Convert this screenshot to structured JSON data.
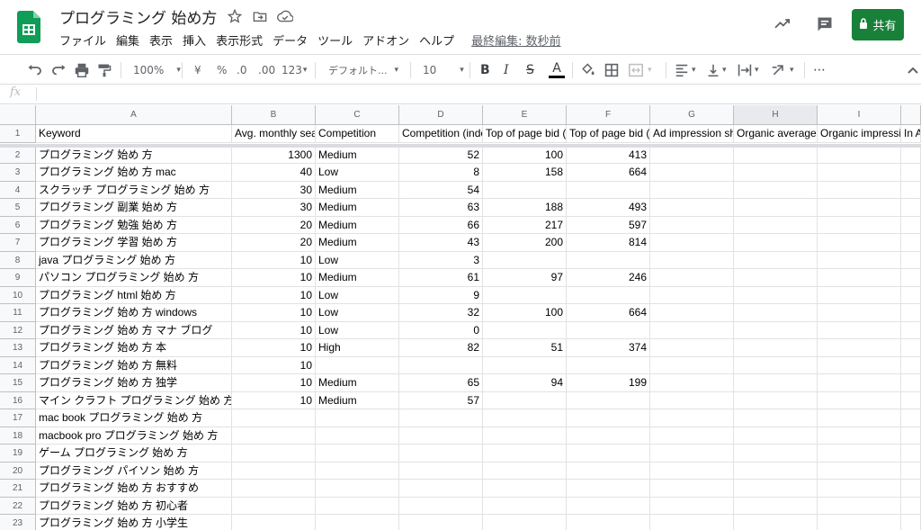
{
  "doc": {
    "title": "プログラミング 始め方",
    "menus": [
      "ファイル",
      "編集",
      "表示",
      "挿入",
      "表示形式",
      "データ",
      "ツール",
      "アドオン",
      "ヘルプ"
    ],
    "last_edit": "最終編集: 数秒前",
    "share_label": "共有"
  },
  "toolbar": {
    "zoom": "100%",
    "currency": "¥",
    "percent": "%",
    "dec_less": ".0",
    "dec_more": ".00",
    "format_more": "123",
    "font": "デフォルト...",
    "font_size": "10",
    "bold": "B",
    "italic": "I",
    "strike": "S",
    "text_color": "A",
    "more": "⋯"
  },
  "formula_bar": {
    "fx": "fx",
    "value": ""
  },
  "colors": {
    "share_green": "#188038",
    "logo_green": "#0f9d58",
    "text_color_bar": "#000000"
  },
  "sheet": {
    "columns": [
      "A",
      "B",
      "C",
      "D",
      "E",
      "F",
      "G",
      "H",
      "I",
      ""
    ],
    "selected_column": "H",
    "rows": [
      [
        "Keyword",
        "Avg. monthly searches",
        "Competition",
        "Competition (indexed value)",
        "Top of page bid (low range)",
        "Top of page bid (high range)",
        "Ad impression share",
        "Organic average position",
        "Organic impression share",
        "In Account"
      ],
      [
        "プログラミング 始め 方",
        "1300",
        "Medium",
        "52",
        "100",
        "413",
        "",
        "",
        "",
        ""
      ],
      [
        "プログラミング 始め 方 mac",
        "40",
        "Low",
        "8",
        "158",
        "664",
        "",
        "",
        "",
        ""
      ],
      [
        "スクラッチ プログラミング 始め 方",
        "30",
        "Medium",
        "54",
        "",
        "",
        "",
        "",
        "",
        ""
      ],
      [
        "プログラミング 副業 始め 方",
        "30",
        "Medium",
        "63",
        "188",
        "493",
        "",
        "",
        "",
        ""
      ],
      [
        "プログラミング 勉強 始め 方",
        "20",
        "Medium",
        "66",
        "217",
        "597",
        "",
        "",
        "",
        ""
      ],
      [
        "プログラミング 学習 始め 方",
        "20",
        "Medium",
        "43",
        "200",
        "814",
        "",
        "",
        "",
        ""
      ],
      [
        "java プログラミング 始め 方",
        "10",
        "Low",
        "3",
        "",
        "",
        "",
        "",
        "",
        ""
      ],
      [
        "パソコン プログラミング 始め 方",
        "10",
        "Medium",
        "61",
        "97",
        "246",
        "",
        "",
        "",
        ""
      ],
      [
        "プログラミング html 始め 方",
        "10",
        "Low",
        "9",
        "",
        "",
        "",
        "",
        "",
        ""
      ],
      [
        "プログラミング 始め 方 windows",
        "10",
        "Low",
        "32",
        "100",
        "664",
        "",
        "",
        "",
        ""
      ],
      [
        "プログラミング 始め 方 マナ ブログ",
        "10",
        "Low",
        "0",
        "",
        "",
        "",
        "",
        "",
        ""
      ],
      [
        "プログラミング 始め 方 本",
        "10",
        "High",
        "82",
        "51",
        "374",
        "",
        "",
        "",
        ""
      ],
      [
        "プログラミング 始め 方 無料",
        "10",
        "",
        "",
        "",
        "",
        "",
        "",
        "",
        ""
      ],
      [
        "プログラミング 始め 方 独学",
        "10",
        "Medium",
        "65",
        "94",
        "199",
        "",
        "",
        "",
        ""
      ],
      [
        "マイン クラフト プログラミング 始め 方",
        "10",
        "Medium",
        "57",
        "",
        "",
        "",
        "",
        "",
        ""
      ],
      [
        "mac book プログラミング 始め 方",
        "",
        "",
        "",
        "",
        "",
        "",
        "",
        "",
        ""
      ],
      [
        "macbook pro プログラミング 始め 方",
        "",
        "",
        "",
        "",
        "",
        "",
        "",
        "",
        ""
      ],
      [
        "ゲーム プログラミング 始め 方",
        "",
        "",
        "",
        "",
        "",
        "",
        "",
        "",
        ""
      ],
      [
        "プログラミング パイソン 始め 方",
        "",
        "",
        "",
        "",
        "",
        "",
        "",
        "",
        ""
      ],
      [
        "プログラミング 始め 方 おすすめ",
        "",
        "",
        "",
        "",
        "",
        "",
        "",
        "",
        ""
      ],
      [
        "プログラミング 始め 方 初心者",
        "",
        "",
        "",
        "",
        "",
        "",
        "",
        "",
        ""
      ],
      [
        "プログラミング 始め 方 小学生",
        "",
        "",
        "",
        "",
        "",
        "",
        "",
        "",
        ""
      ]
    ]
  }
}
